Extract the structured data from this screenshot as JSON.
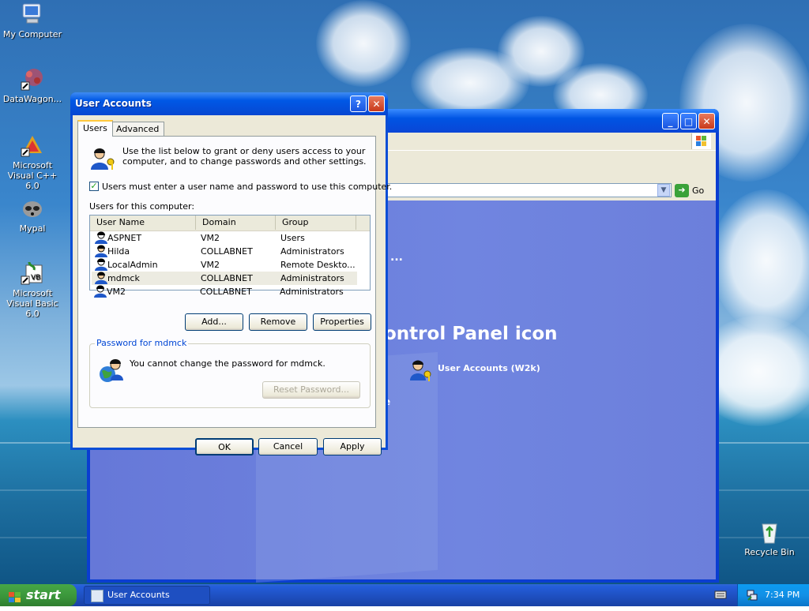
{
  "desktop": {
    "icons": [
      {
        "label": "My Computer"
      },
      {
        "label": "DataWagon..."
      },
      {
        "label": "Microsoft Visual C++ 6.0"
      },
      {
        "label": "Mypal"
      },
      {
        "label": "Microsoft Visual Basic 6.0"
      },
      {
        "label": "Recycle Bin"
      }
    ]
  },
  "background_window": {
    "go_label": "Go",
    "heading_fragment": "ontrol Panel icon",
    "dots": "...",
    "item_label": "User Accounts (W2k)",
    "fragment_e": "e"
  },
  "dialog": {
    "title": "User Accounts",
    "help_glyph": "?",
    "tabs": [
      {
        "label": "Users"
      },
      {
        "label": "Advanced"
      }
    ],
    "intro": [
      "Use the list below to grant or deny users access to your",
      "computer, and to change passwords and other settings."
    ],
    "checkbox_label": "Users must enter a user name and password to use this computer.",
    "checkbox_checked": true,
    "list_caption": "Users for this computer:",
    "columns": {
      "user": "User Name",
      "domain": "Domain",
      "group": "Group"
    },
    "users": [
      {
        "name": "ASPNET",
        "domain": "VM2",
        "group": "Users"
      },
      {
        "name": "Hilda",
        "domain": "COLLABNET",
        "group": "Administrators"
      },
      {
        "name": "LocalAdmin",
        "domain": "VM2",
        "group": "Remote Deskto..."
      },
      {
        "name": "mdmck",
        "domain": "COLLABNET",
        "group": "Administrators"
      },
      {
        "name": "VM2",
        "domain": "COLLABNET",
        "group": "Administrators"
      }
    ],
    "selected_user": "mdmck",
    "buttons": {
      "add": "Add...",
      "remove": "Remove",
      "properties": "Properties"
    },
    "password_group": {
      "label": "Password for mdmck",
      "message": "You cannot change the password for mdmck.",
      "reset": "Reset Password..."
    },
    "footer": {
      "ok": "OK",
      "cancel": "Cancel",
      "apply": "Apply"
    }
  },
  "taskbar": {
    "start_label": "start",
    "task_label": "User Accounts",
    "clock": "7:34 PM"
  }
}
